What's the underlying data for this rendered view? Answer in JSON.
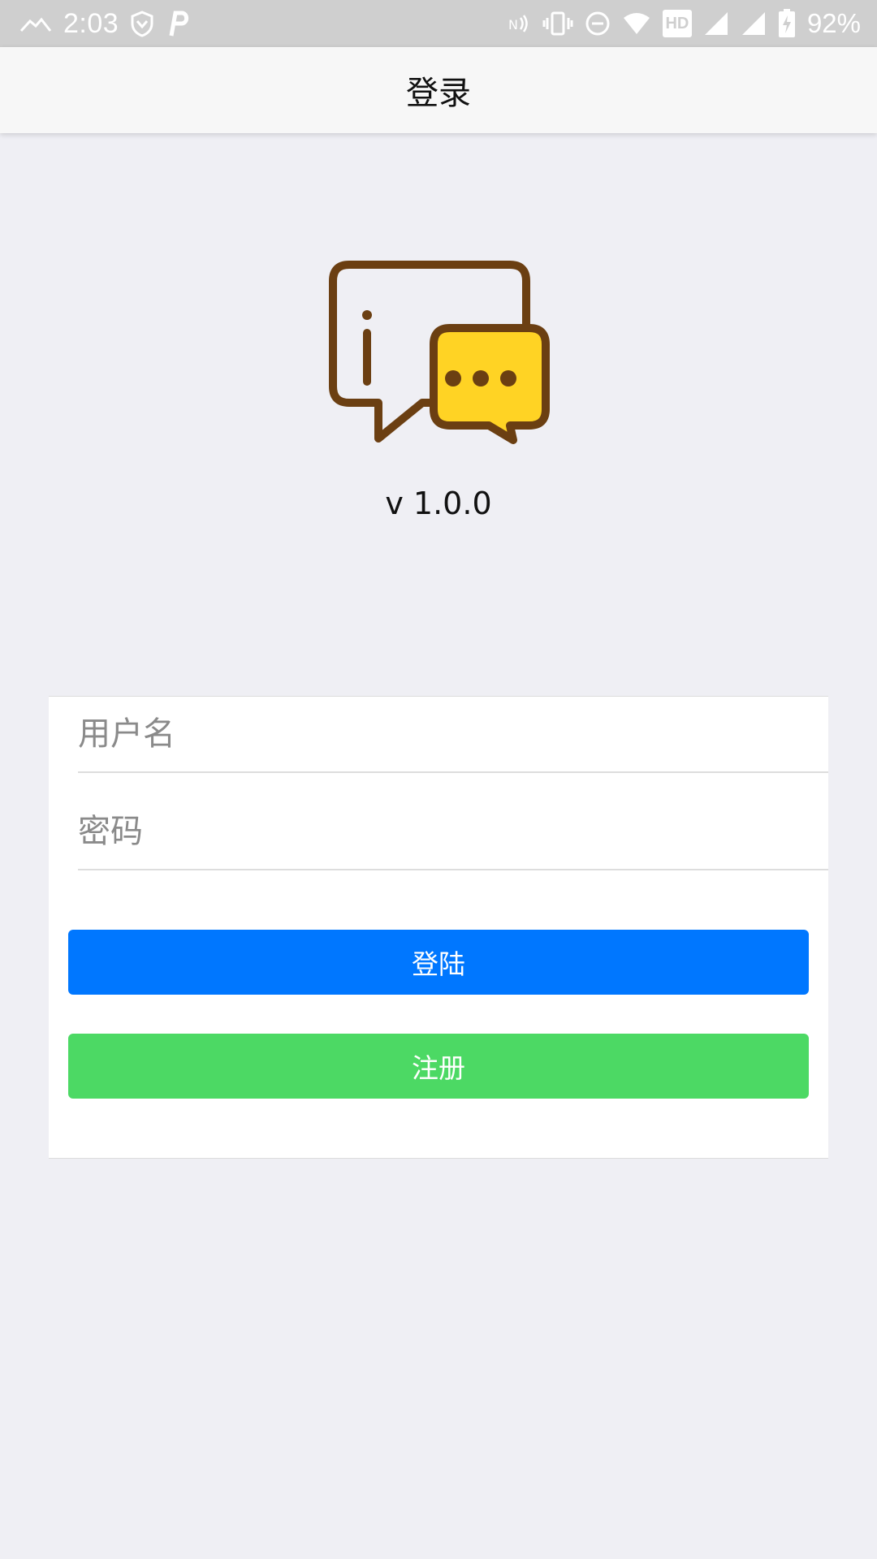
{
  "status_bar": {
    "time": "2:03",
    "battery_percent": "92%",
    "hd_label": "HD",
    "icons": [
      "notification-mountain-icon",
      "shield-icon",
      "p-app-icon",
      "nfc-icon",
      "vibrate-icon",
      "do-not-disturb-icon",
      "wifi-icon",
      "hd-icon",
      "signal-icon",
      "signal-icon",
      "battery-charging-icon"
    ]
  },
  "nav": {
    "title": "登录"
  },
  "app": {
    "logo": "chat-bubbles-logo-icon",
    "version": "v 1.0.0"
  },
  "form": {
    "username_placeholder": "用户名",
    "password_placeholder": "密码",
    "login_label": "登陆",
    "register_label": "注册"
  },
  "colors": {
    "background": "#efeff4",
    "login_button": "#0077ff",
    "register_button": "#4cd964",
    "logo_outline": "#6b3f12",
    "logo_fill": "#ffd324"
  }
}
